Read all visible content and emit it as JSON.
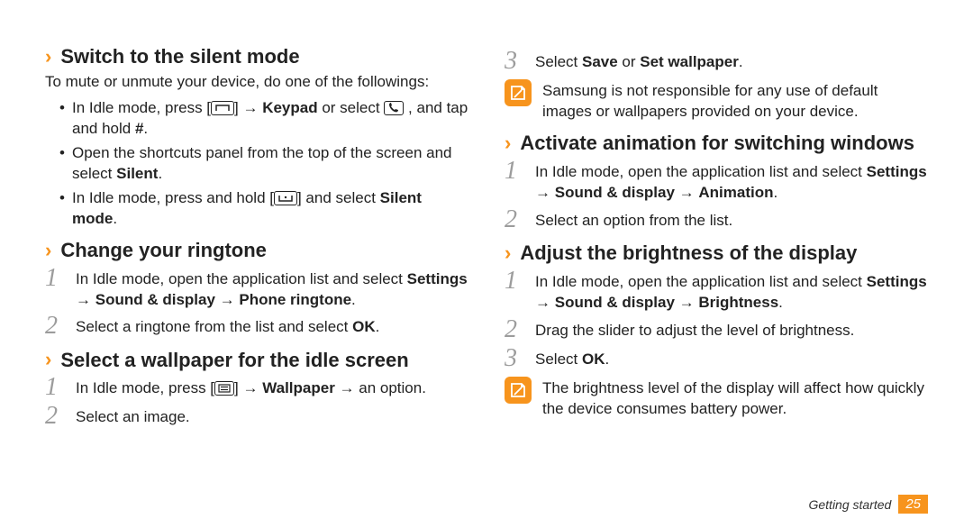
{
  "left": {
    "s1": {
      "title": "Switch to the silent mode",
      "intro": "To mute or unmute your device, do one of the followings:",
      "b1a": "In Idle mode, press [",
      "b1b": "] → ",
      "b1c": "Keypad",
      "b1d": " or select ",
      "b1e": " , and tap and hold ",
      "b1f": "#",
      "b1g": ".",
      "b2a": "Open the shortcuts panel from the top of the screen and select ",
      "b2b": "Silent",
      "b2c": ".",
      "b3a": "In Idle mode, press and hold [",
      "b3b": "] and select ",
      "b3c": "Silent mode",
      "b3d": "."
    },
    "s2": {
      "title": "Change your ringtone",
      "st1a": "In Idle mode, open the application list and select ",
      "st1b": "Settings",
      "st1c": " → ",
      "st1d": "Sound & display",
      "st1e": " → ",
      "st1f": "Phone ringtone",
      "st1g": ".",
      "st2a": "Select a ringtone from the list and select ",
      "st2b": "OK",
      "st2c": "."
    },
    "s3": {
      "title": "Select a wallpaper for the idle screen",
      "st1a": "In Idle mode, press [",
      "st1b": "] → ",
      "st1c": "Wallpaper",
      "st1d": " → an option.",
      "st2": "Select an image."
    }
  },
  "right": {
    "top": {
      "st3a": "Select ",
      "st3b": "Save",
      "st3c": " or ",
      "st3d": "Set wallpaper",
      "st3e": ".",
      "note": "Samsung is not responsible for any use of default images or wallpapers provided on your device."
    },
    "s4": {
      "title": "Activate animation for switching windows",
      "st1a": "In Idle mode, open the application list and select ",
      "st1b": "Settings",
      "st1c": " → ",
      "st1d": "Sound & display",
      "st1e": " → ",
      "st1f": "Animation",
      "st1g": ".",
      "st2": "Select an option from the list."
    },
    "s5": {
      "title": "Adjust the brightness of the display",
      "st1a": "In Idle mode, open the application list and select ",
      "st1b": "Settings",
      "st1c": " → ",
      "st1d": "Sound & display",
      "st1e": " → ",
      "st1f": "Brightness",
      "st1g": ".",
      "st2": "Drag the slider to adjust the level of brightness.",
      "st3a": "Select ",
      "st3b": "OK",
      "st3c": ".",
      "note": "The brightness level of the display will affect how quickly the device consumes battery power."
    }
  },
  "nums": {
    "n1": "1",
    "n2": "2",
    "n3": "3"
  },
  "footer": {
    "label": "Getting started",
    "page": "25"
  }
}
